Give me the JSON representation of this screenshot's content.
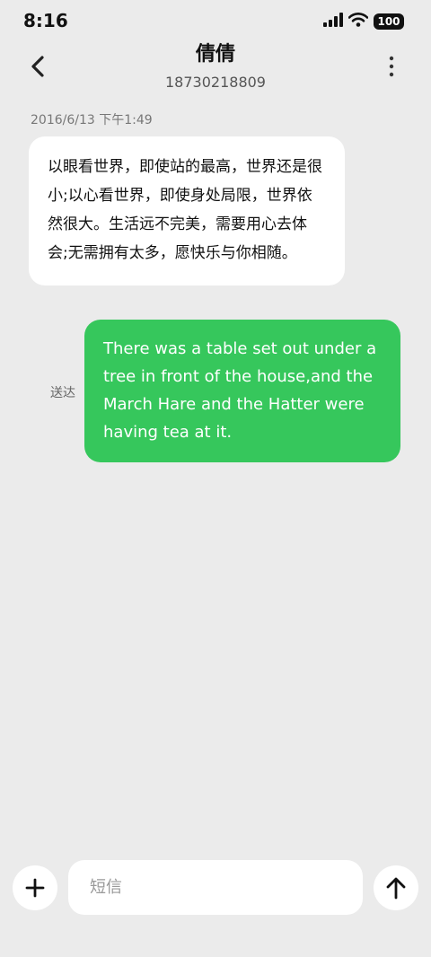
{
  "status_bar": {
    "time": "8:16",
    "battery": "100"
  },
  "header": {
    "contact_name": "倩倩",
    "contact_number": "18730218809"
  },
  "messages": [
    {
      "direction": "incoming",
      "timestamp": "2016/6/13 下午1:49",
      "text": "以眼看世界，即使站的最高，世界还是很小;以心看世界，即使身处局限，世界依然很大。生活远不完美，需要用心去体会;无需拥有太多，愿快乐与你相随。"
    },
    {
      "direction": "outgoing",
      "status": "送达",
      "text": "There was a table set out under a tree in front of the house,and the March Hare and the Hatter were having tea at it."
    }
  ],
  "compose": {
    "placeholder": "短信",
    "value": ""
  },
  "colors": {
    "background": "#ebebeb",
    "outgoing_bubble": "#36c75c",
    "incoming_bubble": "#ffffff"
  },
  "icons": [
    "signal-icon",
    "wifi-icon",
    "battery-icon",
    "back-chevron-icon",
    "more-vertical-icon",
    "plus-icon",
    "send-arrow-icon"
  ]
}
